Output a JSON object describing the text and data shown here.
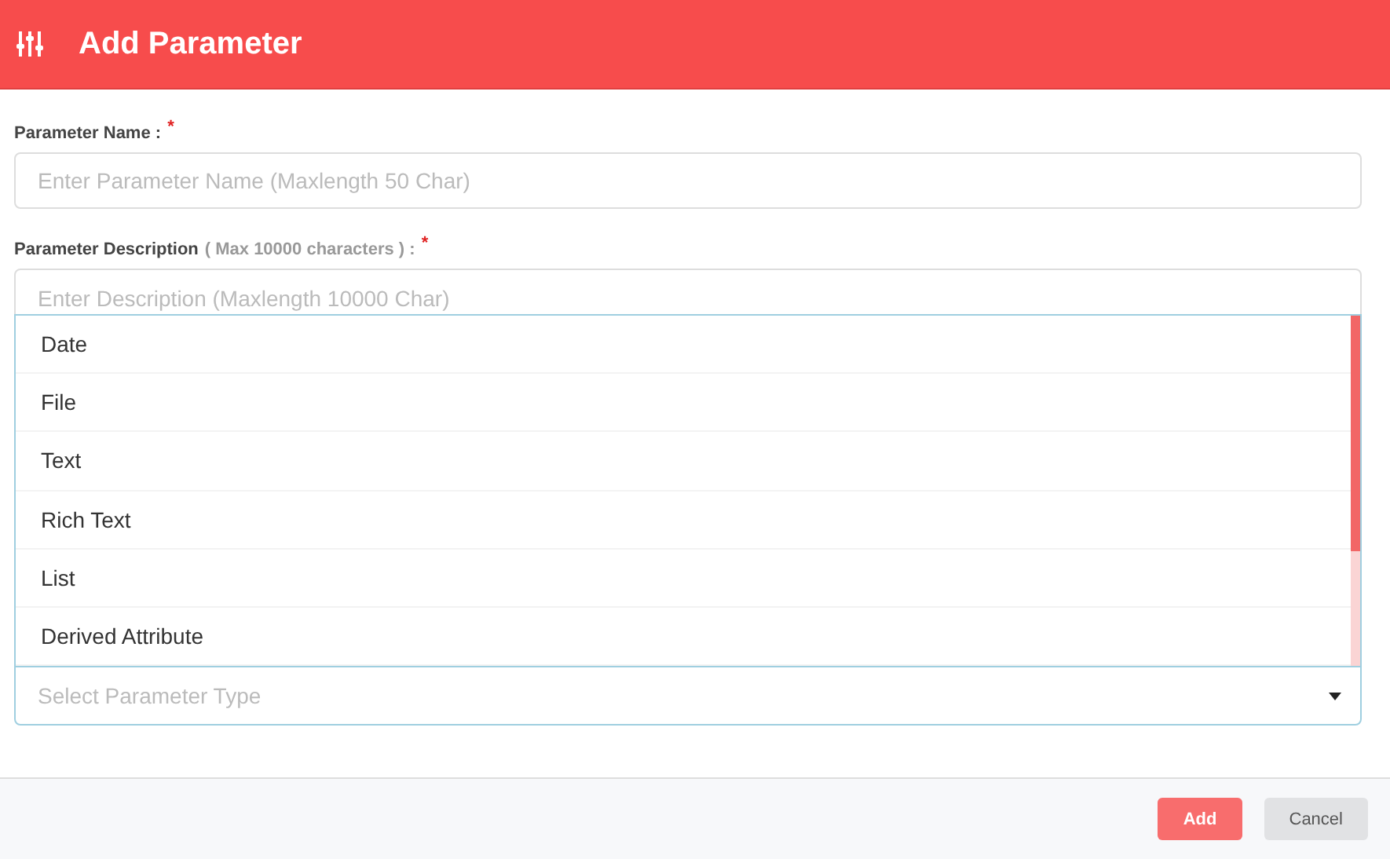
{
  "header": {
    "title": "Add Parameter"
  },
  "fields": [
    {
      "kind": "input",
      "label": "Parameter Name :",
      "required_mark": "*",
      "placeholder": "Enter Parameter Name (Maxlength 50 Char)"
    },
    {
      "kind": "textarea",
      "label": "Parameter Description",
      "note": "( Max 10000 characters ) :",
      "required_mark": "*",
      "placeholder": "Enter Description (Maxlength 10000 Char)"
    }
  ],
  "type_select": {
    "placeholder": "Select Parameter Type",
    "expanded": true,
    "options": [
      "Date",
      "File",
      "Text",
      "Rich Text",
      "List",
      "Derived Attribute"
    ]
  },
  "buttons": [
    {
      "kind": "primary",
      "label": "Add"
    },
    {
      "kind": "secondary",
      "label": "Cancel"
    }
  ]
}
